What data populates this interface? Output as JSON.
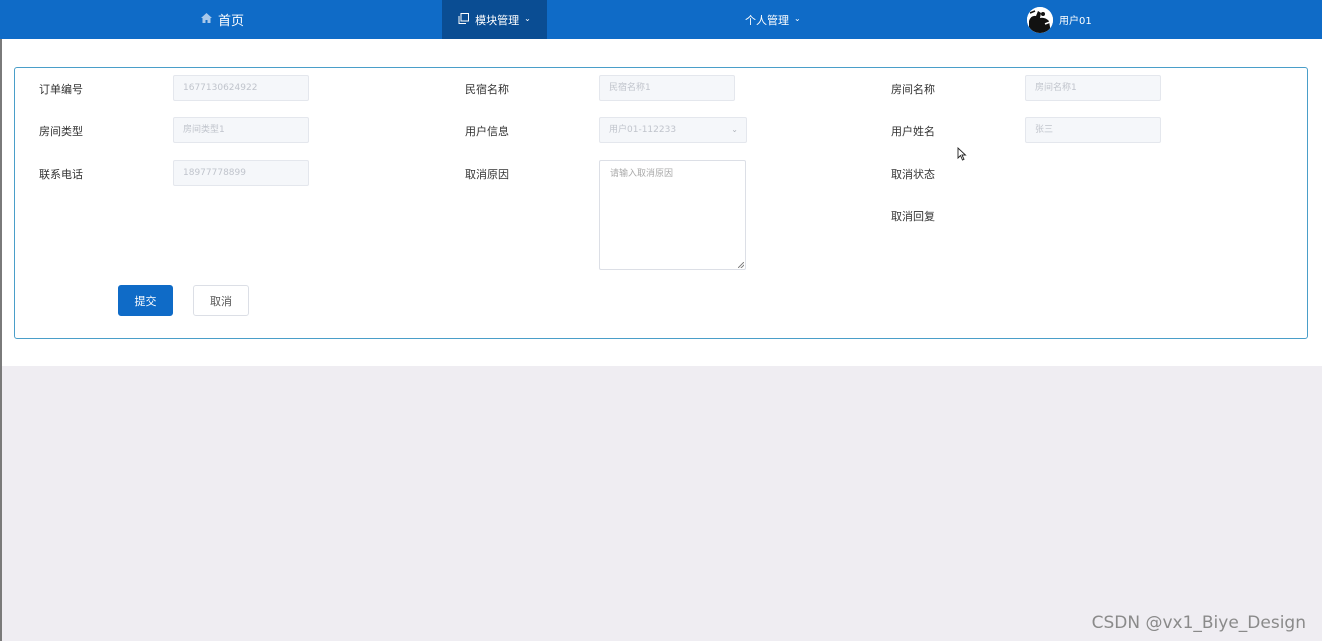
{
  "nav": {
    "home_label": "首页",
    "module_label": "模块管理",
    "personal_label": "个人管理",
    "user_label": "用户01",
    "home_icon": "home-icon",
    "module_icon": "copy-icon"
  },
  "form": {
    "order_no": {
      "label": "订单编号",
      "value": "1677130624922"
    },
    "homestay_name": {
      "label": "民宿名称",
      "value": "民宿名称1"
    },
    "room_name": {
      "label": "房间名称",
      "value": "房间名称1"
    },
    "room_type": {
      "label": "房间类型",
      "value": "房间类型1"
    },
    "user_info": {
      "label": "用户信息",
      "value": "用户01-112233"
    },
    "user_name": {
      "label": "用户姓名",
      "value": "张三"
    },
    "phone": {
      "label": "联系电话",
      "value": "18977778899"
    },
    "cancel_reason": {
      "label": "取消原因",
      "placeholder": "请输入取消原因"
    },
    "cancel_status": {
      "label": "取消状态"
    },
    "cancel_reply": {
      "label": "取消回复"
    }
  },
  "buttons": {
    "submit": "提交",
    "cancel": "取消"
  },
  "watermark": "CSDN @vx1_Biye_Design",
  "colors": {
    "nav_bg": "#0f6bc7",
    "nav_active_bg": "#0a4d93",
    "form_border": "#4a9ec9",
    "page_bg": "#efedf2"
  }
}
